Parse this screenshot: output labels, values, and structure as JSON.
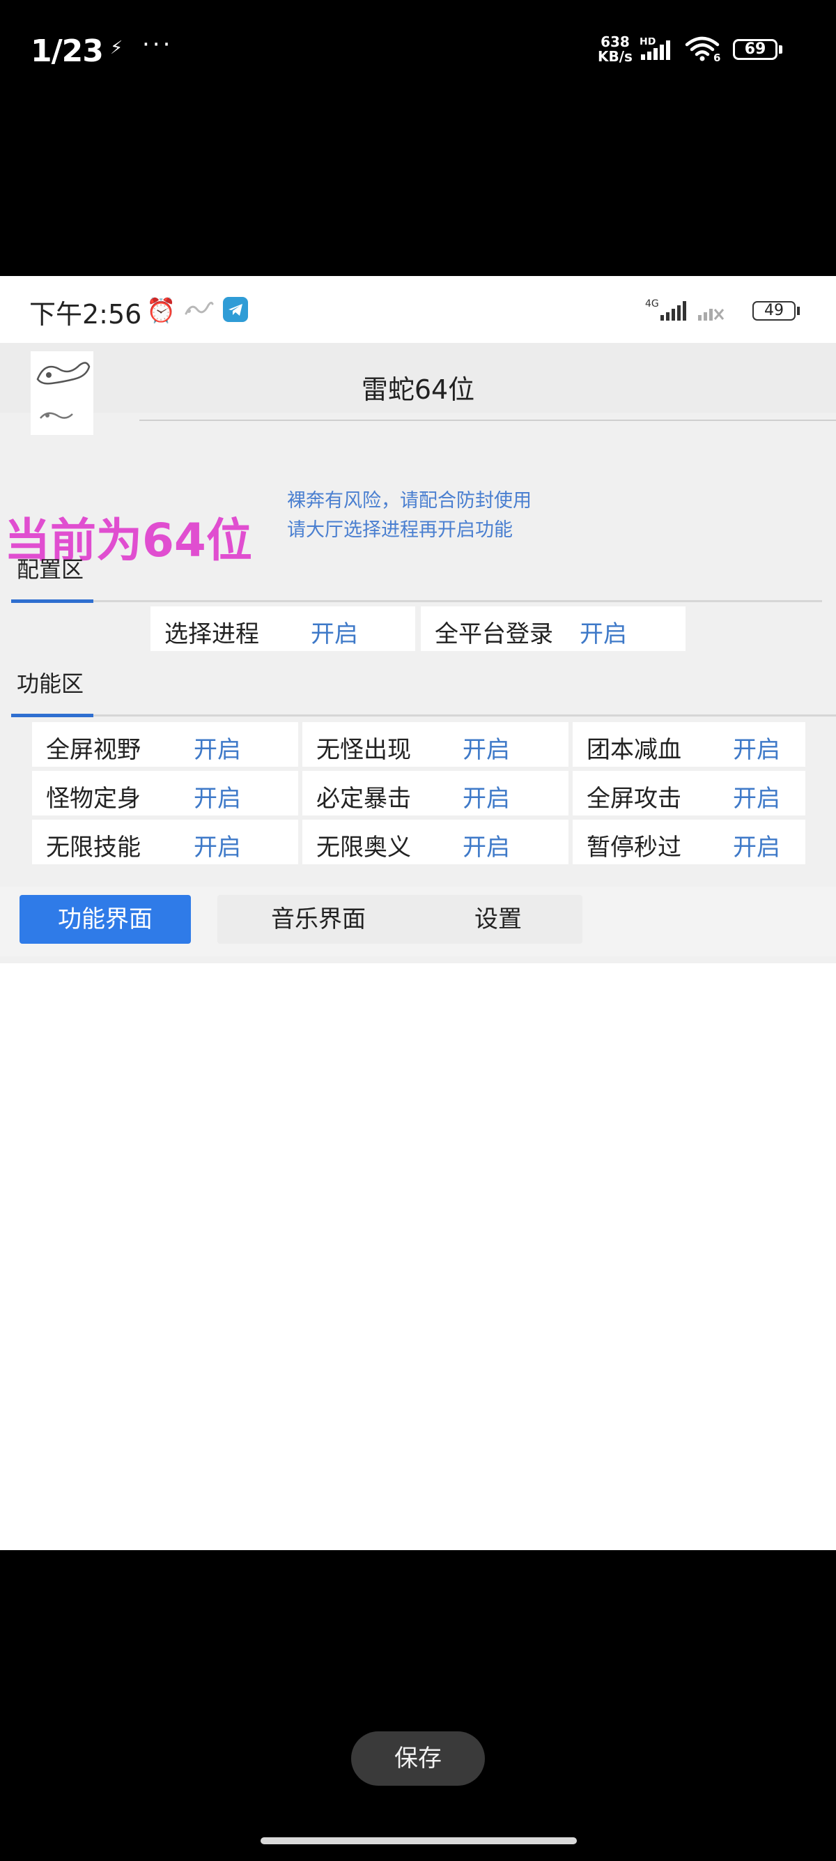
{
  "outer_status": {
    "time": "1/23",
    "speed_value": "638",
    "speed_unit": "KB/s",
    "hd": "HD",
    "wifi_label": "6",
    "battery": "69"
  },
  "inner_status": {
    "time": "下午2:56",
    "network": "4G",
    "battery": "49"
  },
  "app": {
    "title": "雷蛇64位",
    "mode_label": "当前为64位",
    "warning_lines": [
      "裸奔有风险，请配合防封使用",
      "请大厅选择进程再开启功能"
    ],
    "config_section": {
      "title": "配置区",
      "items": [
        {
          "name": "选择进程",
          "toggle": "开启"
        },
        {
          "name": "全平台登录",
          "toggle": "开启"
        }
      ]
    },
    "function_section": {
      "title": "功能区",
      "items": [
        {
          "name": "全屏视野",
          "toggle": "开启"
        },
        {
          "name": "无怪出现",
          "toggle": "开启"
        },
        {
          "name": "团本减血",
          "toggle": "开启"
        },
        {
          "name": "怪物定身",
          "toggle": "开启"
        },
        {
          "name": "必定暴击",
          "toggle": "开启"
        },
        {
          "name": "全屏攻击",
          "toggle": "开启"
        },
        {
          "name": "无限技能",
          "toggle": "开启"
        },
        {
          "name": "无限奥义",
          "toggle": "开启"
        },
        {
          "name": "暂停秒过",
          "toggle": "开启"
        }
      ]
    },
    "nav": {
      "tabs": [
        "功能界面",
        "音乐界面",
        "设置"
      ],
      "active_tab": "功能界面"
    }
  },
  "save_button": "保存",
  "colors": {
    "accent_blue": "#2f7be8",
    "toggle_blue": "#3e79c8",
    "mode_pink": "#e04ed0",
    "warning_blue": "#4a7fd0"
  }
}
